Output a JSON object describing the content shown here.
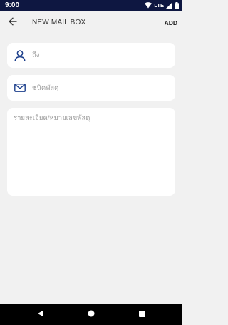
{
  "status_bar": {
    "time": "9:00",
    "network": "LTE",
    "icons": [
      "wifi-icon",
      "signal-icon",
      "battery-icon"
    ]
  },
  "app_bar": {
    "back_icon": "arrow-left-icon",
    "title": "NEW MAIL BOX",
    "action_label": "ADD"
  },
  "form": {
    "recipient": {
      "icon": "person-icon",
      "placeholder": "ถึง",
      "value": ""
    },
    "parcel_type": {
      "icon": "mail-icon",
      "placeholder": "ชนิดพัสดุ",
      "value": ""
    },
    "details": {
      "placeholder": "รายละเอียด/หมายเลขพัสดุ",
      "value": ""
    }
  },
  "nav_bar": {
    "icons": [
      "nav-back-icon",
      "nav-home-icon",
      "nav-recents-icon"
    ]
  },
  "colors": {
    "status_bar": "#0e1741",
    "background": "#f1f1f1",
    "card": "#ffffff",
    "accent_icon": "#1c3f8c",
    "placeholder": "#9a9a9a"
  }
}
